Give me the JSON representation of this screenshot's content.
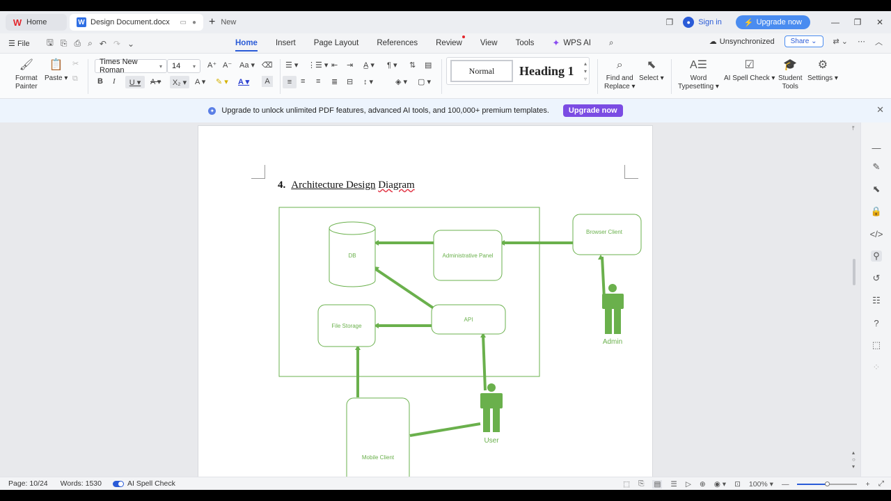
{
  "titlebar": {
    "home_tab": "Home",
    "doc_tab": "Design Document.docx",
    "new_tab": "New",
    "sign_in": "Sign in",
    "upgrade": "Upgrade now"
  },
  "menu": {
    "file": "File",
    "tabs": [
      {
        "label": "Home",
        "active": true
      },
      {
        "label": "Insert"
      },
      {
        "label": "Page Layout"
      },
      {
        "label": "References"
      },
      {
        "label": "Review",
        "dot": true
      },
      {
        "label": "View"
      },
      {
        "label": "Tools"
      }
    ],
    "wps_ai": "WPS AI",
    "unsync": "Unsynchronized",
    "share": "Share"
  },
  "ribbon": {
    "format_painter": "Format\nPainter",
    "format_painter_1": "Format",
    "format_painter_2": "Painter",
    "paste": "Paste",
    "font_name": "Times New Roman",
    "font_size": "14",
    "style_normal": "Normal",
    "style_heading": "Heading 1",
    "find_replace_1": "Find and",
    "find_replace_2": "Replace",
    "select": "Select",
    "word_typesetting_1": "Word",
    "word_typesetting_2": "Typesetting",
    "ai_spell": "AI Spell Check",
    "student_tools_1": "Student",
    "student_tools_2": "Tools",
    "settings": "Settings"
  },
  "banner": {
    "text": "Upgrade to unlock unlimited PDF features, advanced AI tools, and 100,000+ premium templates.",
    "button": "Upgrade now"
  },
  "document": {
    "heading_number": "4.",
    "heading_words_a": "Architecture Design",
    "heading_word_b": "Diagram",
    "diagram": {
      "db": "DB",
      "admin_panel": "Administrative Panel",
      "browser_client": "Browser Client",
      "api": "API",
      "file_storage": "File Storage",
      "mobile_client": "Mobile Client",
      "admin_actor": "Admin",
      "user_actor": "User",
      "accent": "#6ab04c"
    }
  },
  "status": {
    "page": "Page: 10/24",
    "words": "Words: 1530",
    "ai_spell": "AI Spell Check",
    "zoom": "100%"
  }
}
